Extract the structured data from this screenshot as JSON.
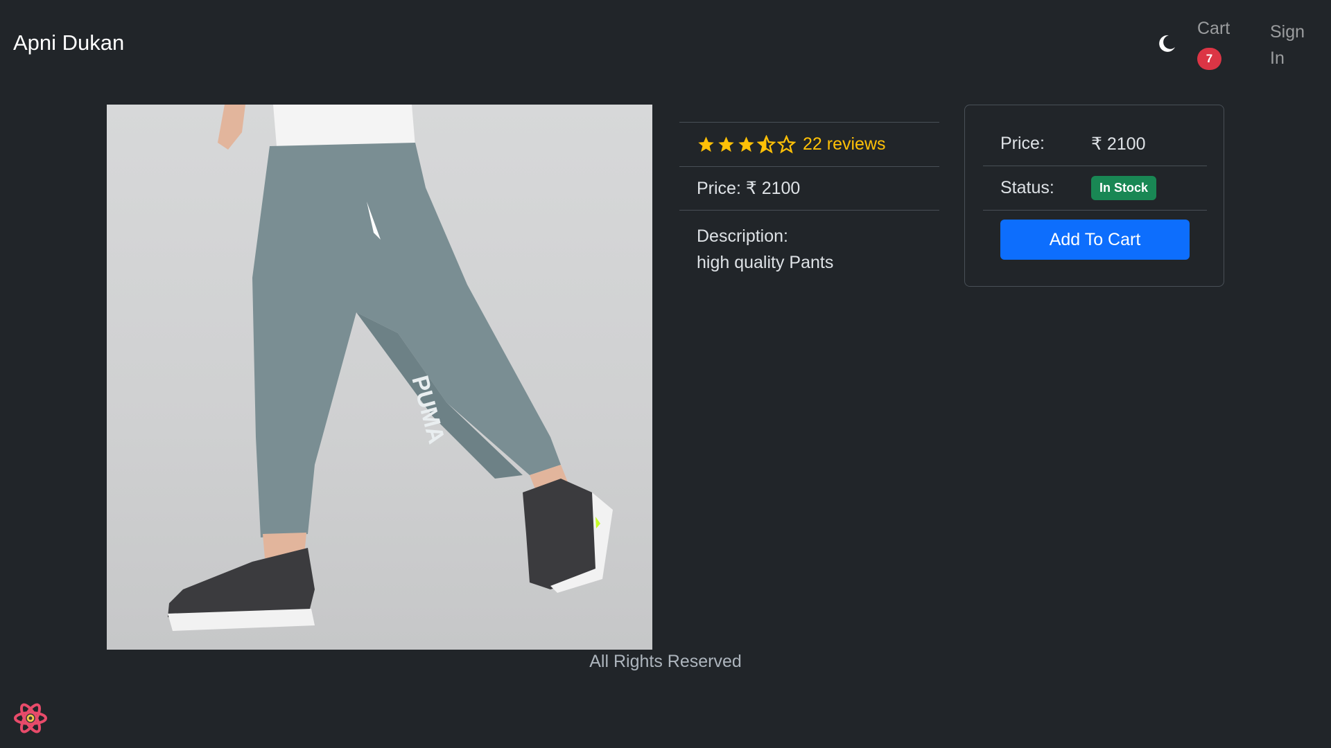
{
  "navbar": {
    "brand": "Apni Dukan",
    "theme_icon": "moon-icon",
    "cart_label": "Cart",
    "cart_count": "7",
    "signin_label": "Sign In"
  },
  "product": {
    "image_icon": "product-photo-pants",
    "rating": 3.5,
    "reviews_text": "22 reviews",
    "price_line": "Price: ₹ 2100",
    "description_label": "Description:",
    "description_text": "high quality Pants"
  },
  "purchase_card": {
    "price_label": "Price:",
    "price_value": "₹ 2100",
    "status_label": "Status:",
    "status_value": "In Stock",
    "add_button": "Add To Cart"
  },
  "footer": {
    "text": "All Rights Reserved"
  },
  "colors": {
    "background": "#212529",
    "accent_blue": "#0d6efd",
    "badge_red": "#dc3545",
    "stock_green": "#198754",
    "star_yellow": "#ffc107"
  },
  "floating_icon": "react-logo-icon"
}
